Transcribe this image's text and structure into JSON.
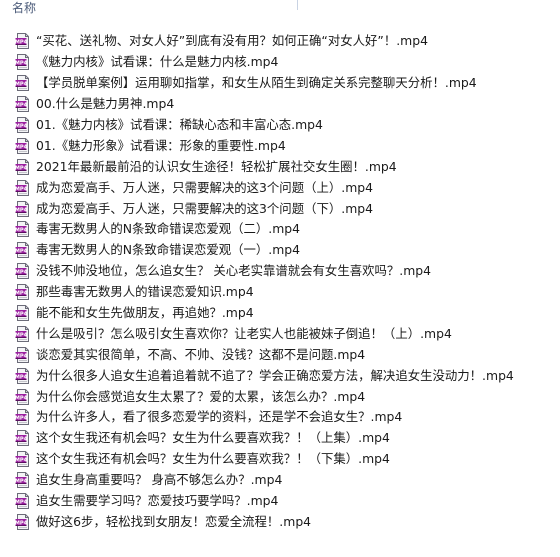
{
  "header": {
    "name_column": "名称"
  },
  "icon": {
    "name": "mp4-video-file-icon",
    "page_color": "#f4f4f6",
    "border_color": "#6b6b78",
    "badge_color": "#9b1fa0",
    "badge_dark": "#5a0e60",
    "badge_text": "MP4"
  },
  "files": [
    "“买花、送礼物、对女人好”到底有没有用？如何正确“对女人好”！.mp4",
    "《魅力内核》试看课：什么是魅力内核.mp4",
    "【学员脱单案例】运用聊如指掌，和女生从陌生到确定关系完整聊天分析！.mp4",
    "00.什么是魅力男神.mp4",
    "01.《魅力内核》试看课：稀缺心态和丰富心态.mp4",
    "01.《魅力形象》试看课：形象的重要性.mp4",
    "2021年最新最前沿的认识女生途径！轻松扩展社交女生圈！.mp4",
    "成为恋爱高手、万人迷，只需要解决的这3个问题（上）.mp4",
    "成为恋爱高手、万人迷，只需要解决的这3个问题（下）.mp4",
    "毒害无数男人的N条致命错误恋爱观（二）.mp4",
    "毒害无数男人的N条致命错误恋爱观（一）.mp4",
    "没钱不帅没地位，怎么追女生？ 关心老实靠谱就会有女生喜欢吗？.mp4",
    "那些毒害无数男人的错误恋爱知识.mp4",
    "能不能和女生先做朋友，再追她？.mp4",
    "什么是吸引？怎么吸引女生喜欢你？让老实人也能被妹子倒追！（上）.mp4",
    "谈恋爱其实很简单，不高、不帅、没钱？这都不是问题.mp4",
    "为什么很多人追女生追着追着就不追了？学会正确恋爱方法，解决追女生没动力！.mp4",
    "为什么你会感觉追女生太累了？爱的太累，该怎么办？.mp4",
    "为什么许多人，看了很多恋爱学的资料，还是学不会追女生？.mp4",
    "这个女生我还有机会吗？女生为什么要喜欢我？！（上集）.mp4",
    "这个女生我还有机会吗？女生为什么要喜欢我？！（下集）.mp4",
    "追女生身高重要吗？ 身高不够怎么办？.mp4",
    "追女生需要学习吗？恋爱技巧要学吗？.mp4",
    "做好这6步，轻松找到女朋友！恋爱全流程！.mp4"
  ]
}
